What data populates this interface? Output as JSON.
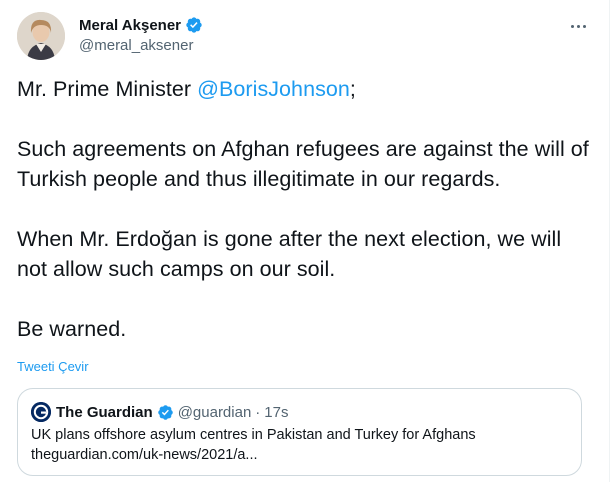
{
  "tweet": {
    "author": {
      "name": "Meral Akşener",
      "handle": "@meral_aksener"
    },
    "text": {
      "p1_prefix": "Mr. Prime Minister ",
      "p1_mention": "@BorisJohnson",
      "p1_suffix": ";",
      "p2": "Such agreements on Afghan refugees are against the will of Turkish people and thus illegitimate in our regards.",
      "p3": "When Mr. Erdoğan is gone after the next election, we will not allow such camps on our soil.",
      "p4": "Be warned."
    },
    "translate_label": "Tweeti Çevir"
  },
  "quote": {
    "author": {
      "name": "The Guardian",
      "handle": "@guardian"
    },
    "separator": "·",
    "time": "17s",
    "headline": "UK plans offshore asylum centres in Pakistan and Turkey for Afghans",
    "link": "theguardian.com/uk-news/2021/a..."
  },
  "colors": {
    "accent": "#1d9bf0",
    "secondary_text": "#536471",
    "border": "#cfd9de",
    "guardian_blue": "#052962"
  },
  "icons": {
    "verified": "verified-badge-icon",
    "more": "more-options-icon"
  }
}
